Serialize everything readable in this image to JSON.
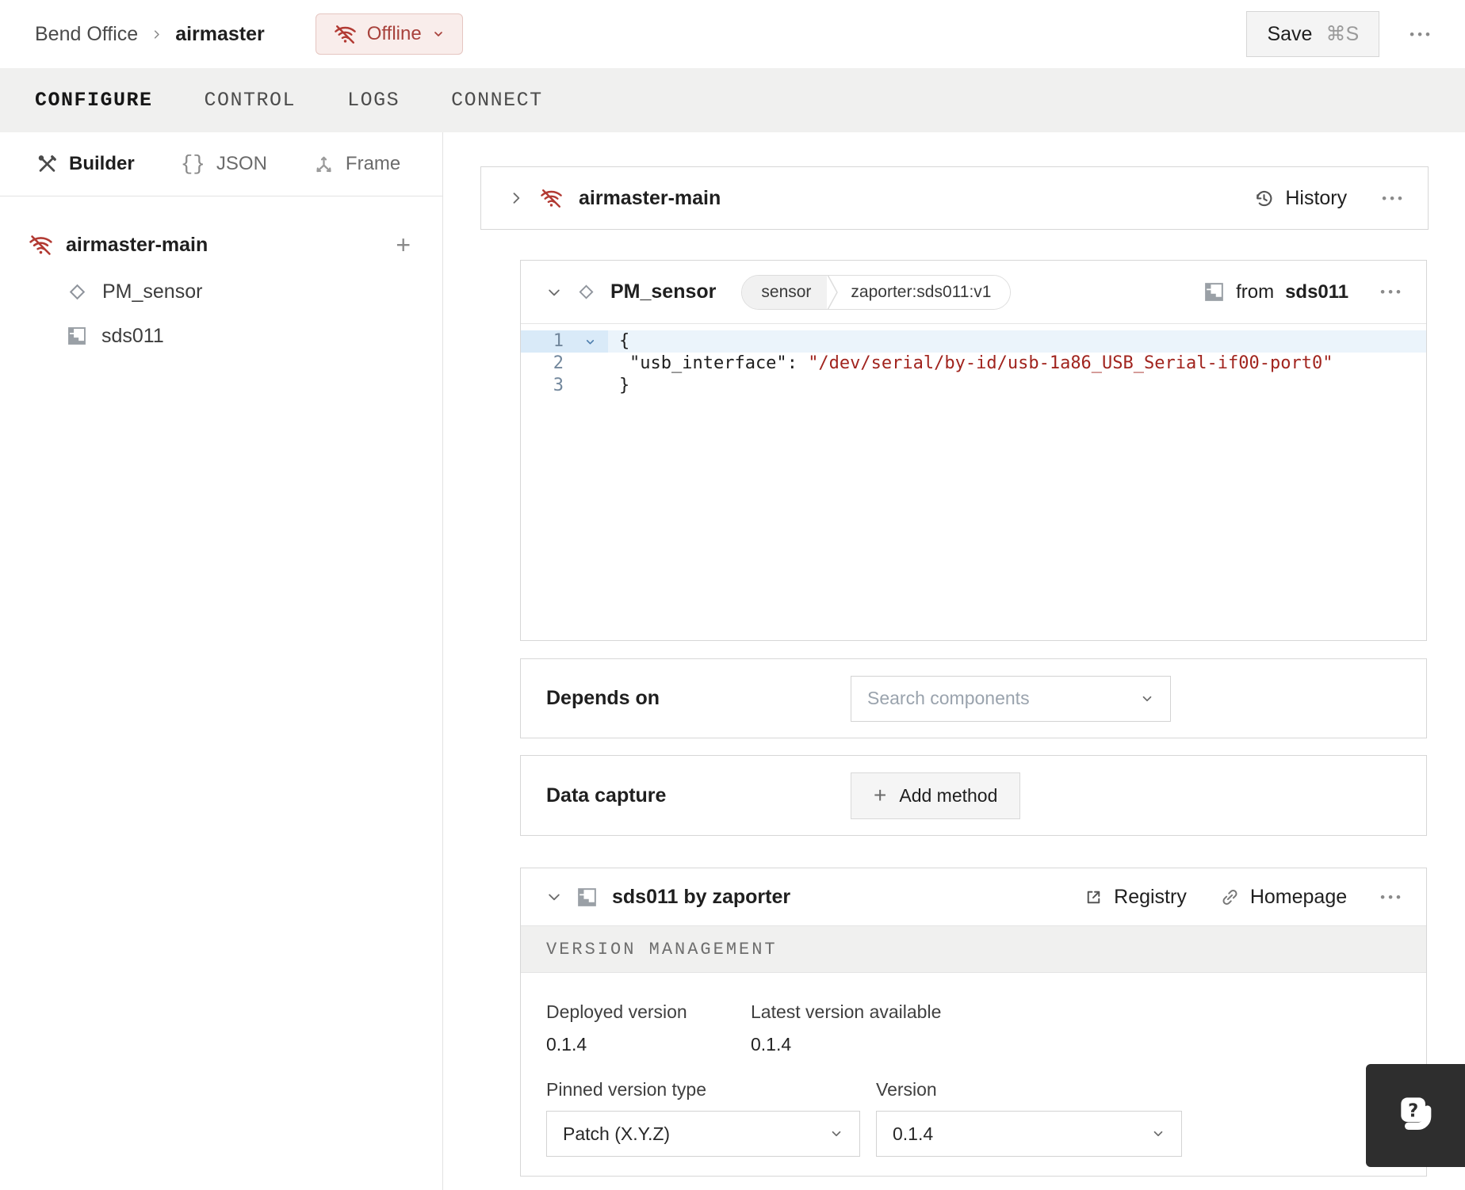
{
  "topbar": {
    "breadcrumb": {
      "parent": "Bend Office",
      "current": "airmaster"
    },
    "status": {
      "label": "Offline"
    },
    "save": {
      "label": "Save",
      "shortcut": "⌘S"
    }
  },
  "tabs": [
    {
      "label": "CONFIGURE",
      "active": true
    },
    {
      "label": "CONTROL",
      "active": false
    },
    {
      "label": "LOGS",
      "active": false
    },
    {
      "label": "CONNECT",
      "active": false
    }
  ],
  "sidebar": {
    "modes": [
      {
        "label": "Builder",
        "active": true
      },
      {
        "label": "JSON",
        "active": false
      },
      {
        "label": "Frame",
        "active": false
      }
    ],
    "tree": {
      "root": "airmaster-main",
      "children": [
        "PM_sensor",
        "sds011"
      ]
    }
  },
  "main": {
    "machine_card": {
      "title": "airmaster-main",
      "history": "History"
    },
    "component_card": {
      "title": "PM_sensor",
      "type_badge": "sensor",
      "model_badge": "zaporter:sds011:v1",
      "from_label": "from",
      "from_target": "sds011",
      "code": {
        "line_numbers": [
          "1",
          "2",
          "3"
        ],
        "open_brace": "{",
        "key": "\"usb_interface\"",
        "colon": ": ",
        "value": "\"/dev/serial/by-id/usb-1a86_USB_Serial-if00-port0\"",
        "close_brace": "}"
      }
    },
    "depends_on": {
      "label": "Depends on",
      "placeholder": "Search components"
    },
    "data_capture": {
      "label": "Data capture",
      "button": "Add method"
    },
    "module_card": {
      "title": "sds011 by zaporter",
      "registry": "Registry",
      "homepage": "Homepage",
      "section": "VERSION MANAGEMENT",
      "deployed_label": "Deployed version",
      "deployed_value": "0.1.4",
      "latest_label": "Latest version available",
      "latest_value": "0.1.4",
      "pinned_label": "Pinned version type",
      "pinned_value": "Patch (X.Y.Z)",
      "version_label": "Version",
      "version_value": "0.1.4"
    }
  },
  "icons": {
    "overflow": "•••",
    "plus": "+",
    "braces": "{}"
  },
  "colors": {
    "status_offline_text": "#a8423c",
    "status_offline_bg": "#f9edeb",
    "status_offline_border": "#e5c6c1",
    "icon_red": "#b23a33",
    "code_string": "#a1241e",
    "code_line_number": "#72879c",
    "active_line_bg": "#ebf4fb",
    "card_border": "#d7d7d7",
    "tabbar_bg": "#f0f0ef"
  }
}
